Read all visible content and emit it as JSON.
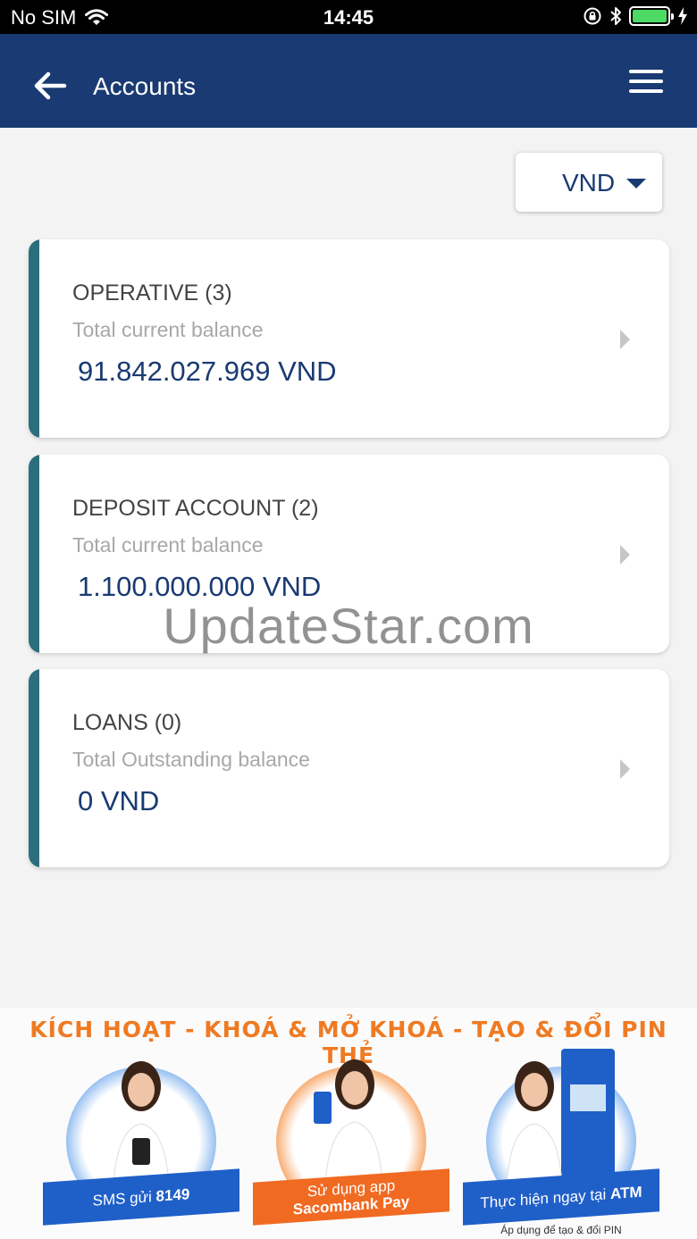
{
  "status_bar": {
    "carrier": "No SIM",
    "time": "14:45"
  },
  "header": {
    "title": "Accounts"
  },
  "currency": {
    "selected": "VND"
  },
  "accounts": [
    {
      "title": "OPERATIVE (3)",
      "subtitle": "Total current balance",
      "amount": "91.842.027.969 VND"
    },
    {
      "title": "DEPOSIT ACCOUNT (2)",
      "subtitle": "Total current balance",
      "amount": "1.100.000.000 VND"
    },
    {
      "title": "LOANS (0)",
      "subtitle": "Total Outstanding balance",
      "amount": "0 VND"
    }
  ],
  "watermark": "UpdateStar.com",
  "promo": {
    "headline": "KÍCH HOẠT - KHOÁ & MỞ KHOÁ - TẠO & ĐỔI PIN THẺ",
    "panels": [
      {
        "line1": "SMS gửi",
        "line1_bold": "8149",
        "line2": ""
      },
      {
        "line1": "Sử dụng app",
        "line1_bold": "",
        "line2": "Sacombank Pay"
      },
      {
        "line1": "Thực hiện ngay tại",
        "line1_bold": "ATM",
        "line2": ""
      }
    ],
    "note": "Áp dụng để tạo & đổi PIN",
    "colors": {
      "headline": "#ef7a22",
      "blue_ribbon": "#1f5fc8",
      "orange_ribbon": "#f06a22"
    }
  },
  "colors": {
    "header_bg": "#193a72",
    "accent_bar": "#2c6e7c",
    "amount_text": "#193a72"
  }
}
